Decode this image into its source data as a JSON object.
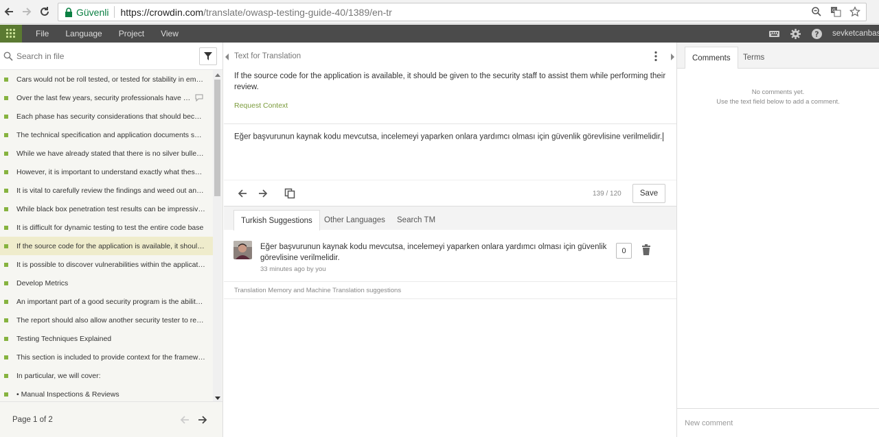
{
  "browser": {
    "secure_label": "Güvenli",
    "url_host": "https://crowdin.com",
    "url_path": "/translate/owasp-testing-guide-40/1389/en-tr"
  },
  "menu": {
    "items": [
      "File",
      "Language",
      "Project",
      "View"
    ],
    "username": "sevketcanbas"
  },
  "left": {
    "search_placeholder": "Search in file",
    "strings": [
      "Cars would not be roll tested, or tested for stability in emergency maneuvers",
      "Over the last few years, security professionals have come to",
      "Each phase has security considerations that should become part of",
      "The technical specification and application documents should be",
      "While we have already stated that there is no silver bullet for",
      "However, it is important to understand exactly what these tools",
      "It is vital to carefully review the findings and weed out any false",
      "While black box penetration test results can be impressive and",
      "It is difficult for dynamic testing to test the entire code base",
      "If the source code for the application is available, it should be given",
      "It is possible to discover vulnerabilities within the application",
      "Develop Metrics",
      "An important part of a good security program is the ability to",
      "The report should also allow another security tester to reproduce",
      "Testing Techniques Explained",
      "This section is included to provide context for the framework",
      "In particular, we will cover:",
      "• Manual Inspections & Reviews"
    ],
    "page_label": "Page 1 of 2"
  },
  "middle": {
    "source_header": "Text for Translation",
    "source_text": "If the source code for the application is available, it should be given to the security staff to assist them while performing their review.",
    "request_context": "Request Context",
    "translation": "Eğer başvurunun kaynak kodu mevcutsa, incelemeyi yaparken onlara yardımcı olması için güvenlik görevlisine verilmelidir.",
    "counter": "139 / 120",
    "save_label": "Save",
    "tabs": [
      "Turkish Suggestions",
      "Other Languages",
      "Search TM"
    ],
    "suggestion": {
      "text": "Eğer başvurunun kaynak kodu mevcutsa, incelemeyi yaparken onlara yardımcı olması için güvenlik görevlisine verilmelidir.",
      "meta": "33 minutes ago by you",
      "votes": "0"
    },
    "tm_label": "Translation Memory and Machine Translation suggestions"
  },
  "right": {
    "tabs": [
      "Comments",
      "Terms"
    ],
    "no_comments_1": "No comments yet.",
    "no_comments_2": "Use the text field below to add a comment.",
    "new_comment_placeholder": "New comment"
  },
  "colors": {
    "accent_green": "#86b33f",
    "topbar": "#4b4b4b",
    "active_row": "#efeccc"
  }
}
